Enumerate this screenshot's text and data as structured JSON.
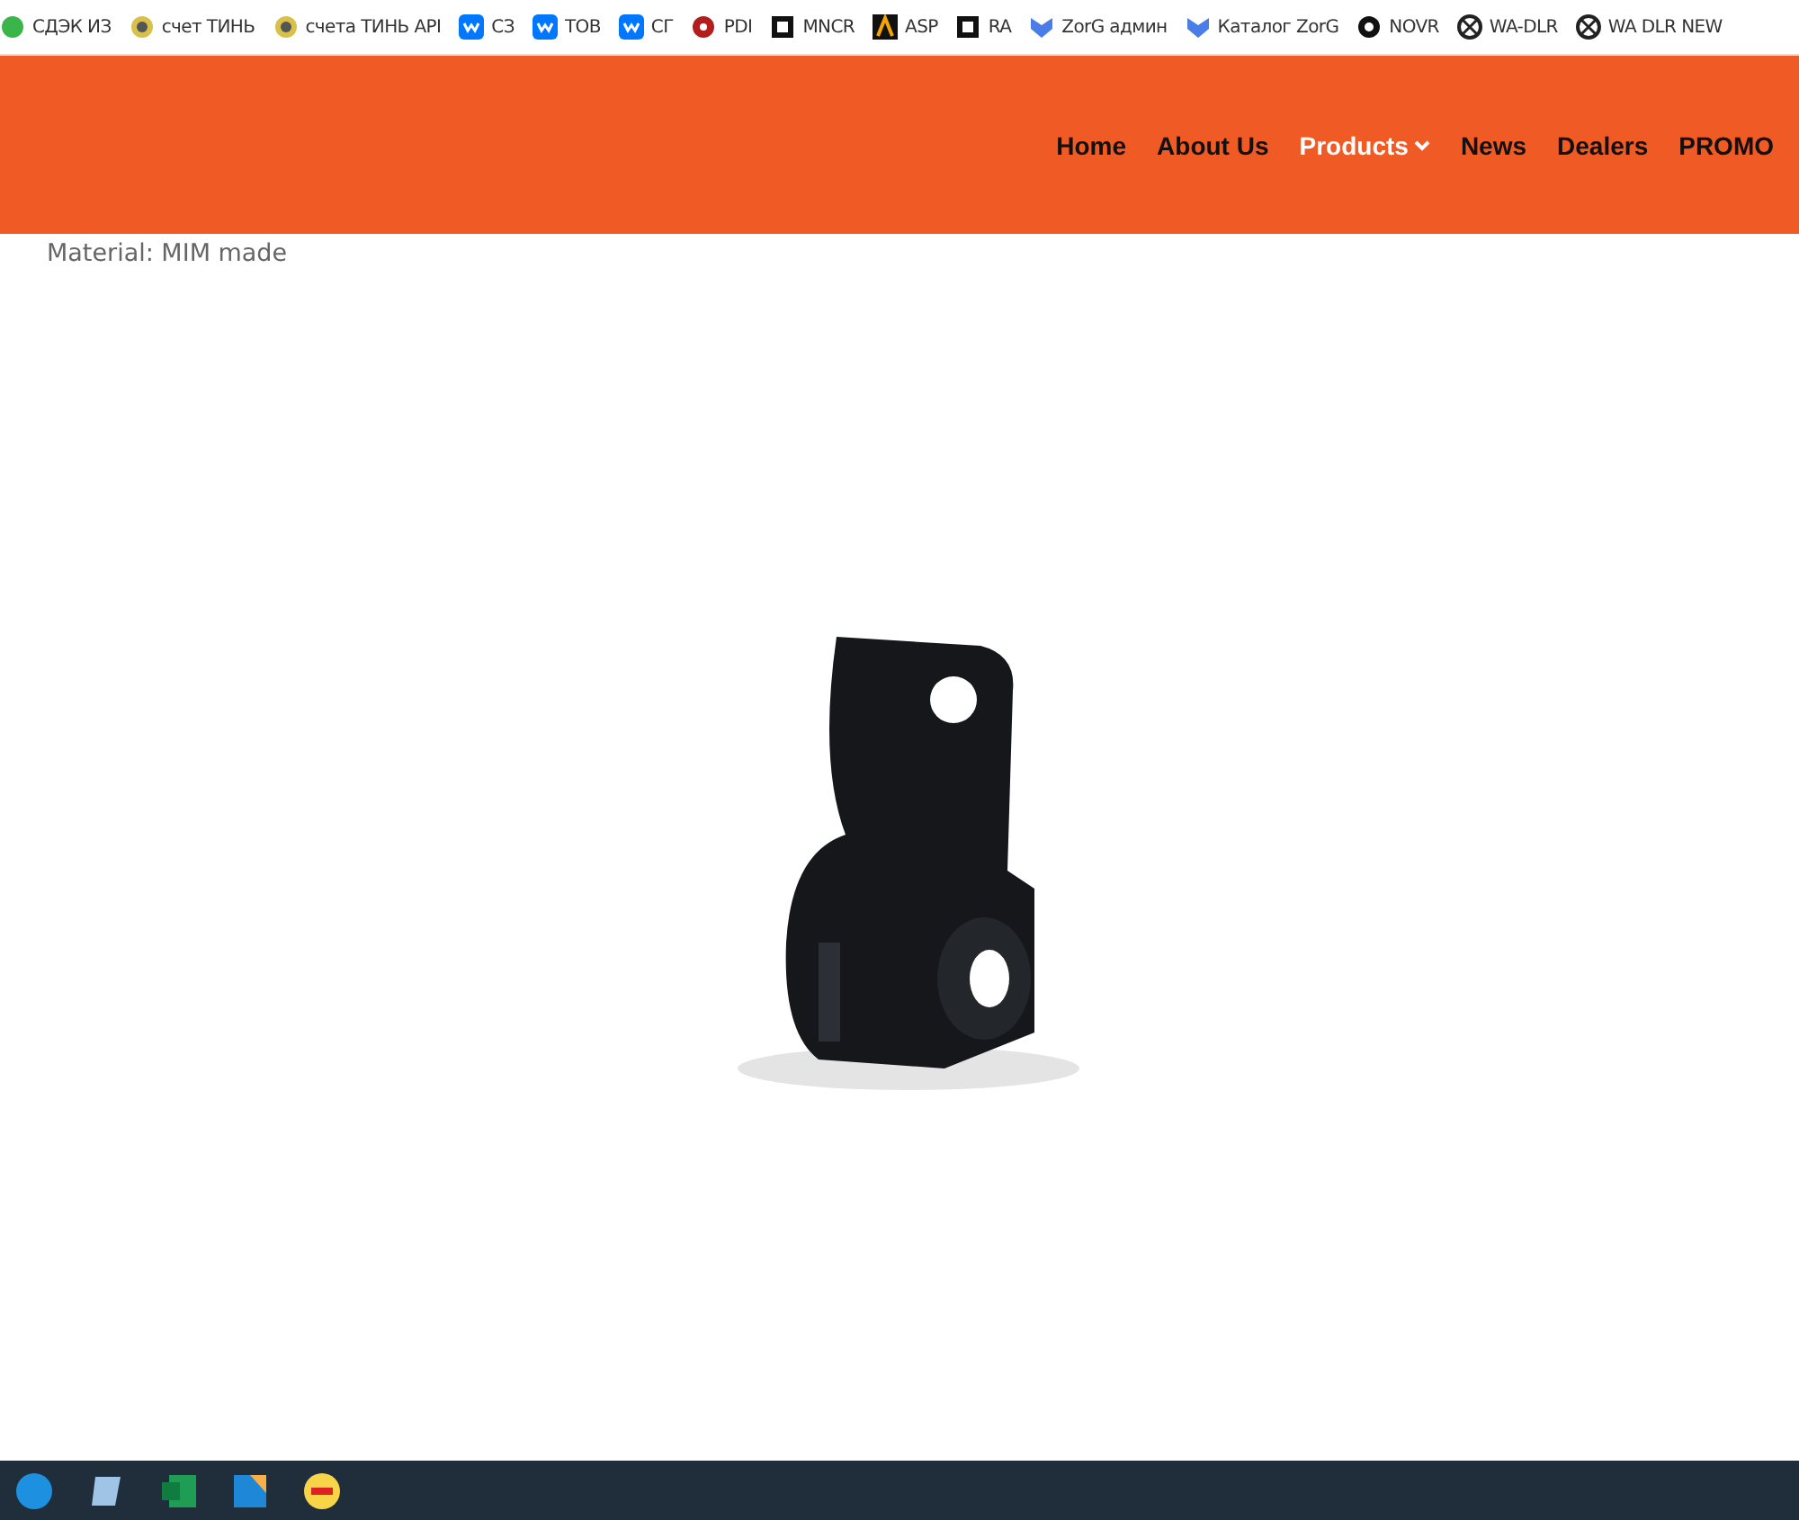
{
  "bookmarks": [
    {
      "label": "СДЭК ИЗ",
      "kind": "dot"
    },
    {
      "label": "счет ТИНЬ",
      "kind": "shield"
    },
    {
      "label": "счета ТИНЬ API",
      "kind": "shield"
    },
    {
      "label": "СЗ",
      "kind": "vk"
    },
    {
      "label": "ТОВ",
      "kind": "vk"
    },
    {
      "label": "СГ",
      "kind": "vk"
    },
    {
      "label": "PDI",
      "kind": "round"
    },
    {
      "label": "MNCR",
      "kind": "square"
    },
    {
      "label": "ASP",
      "kind": "arch"
    },
    {
      "label": "RA",
      "kind": "square"
    },
    {
      "label": "ZorG админ",
      "kind": "chevron"
    },
    {
      "label": "Каталог ZorG",
      "kind": "chevron"
    },
    {
      "label": "NOVR",
      "kind": "wheel"
    },
    {
      "label": "WA-DLR",
      "kind": "knot"
    },
    {
      "label": "WA DLR NEW",
      "kind": "knot"
    }
  ],
  "nav": [
    {
      "label": "Home",
      "selected": false,
      "dropdown": false
    },
    {
      "label": "About Us",
      "selected": false,
      "dropdown": false
    },
    {
      "label": "Products",
      "selected": true,
      "dropdown": true
    },
    {
      "label": "News",
      "selected": false,
      "dropdown": false
    },
    {
      "label": "Dealers",
      "selected": false,
      "dropdown": false
    },
    {
      "label": "PROMO",
      "selected": false,
      "dropdown": false
    }
  ],
  "material": "Material: MIM made",
  "taskbar": [
    {
      "kind": "blue"
    },
    {
      "kind": "notepad"
    },
    {
      "kind": "excel"
    },
    {
      "kind": "files"
    },
    {
      "kind": "onec"
    }
  ]
}
